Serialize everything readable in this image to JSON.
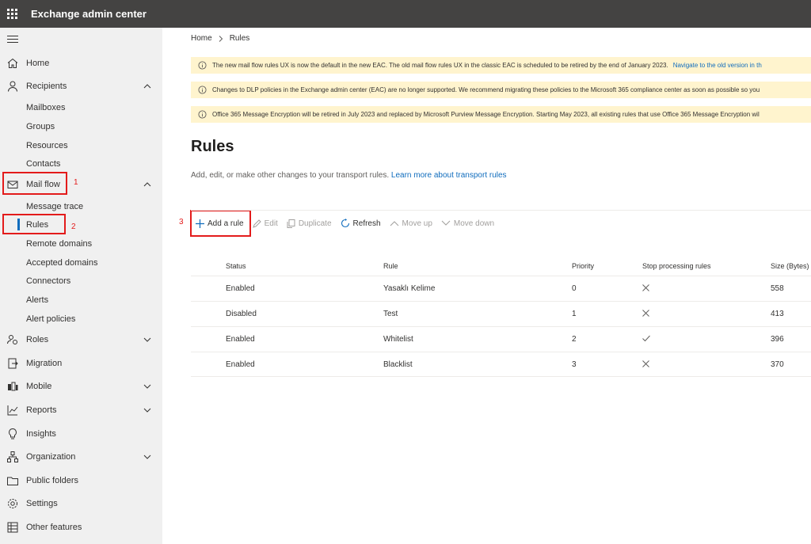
{
  "app": {
    "title": "Exchange admin center"
  },
  "sidebar": {
    "items": [
      {
        "label": "Home"
      },
      {
        "label": "Recipients"
      },
      {
        "label": "Mail flow"
      },
      {
        "label": "Roles"
      },
      {
        "label": "Migration"
      },
      {
        "label": "Mobile"
      },
      {
        "label": "Reports"
      },
      {
        "label": "Insights"
      },
      {
        "label": "Organization"
      },
      {
        "label": "Public folders"
      },
      {
        "label": "Settings"
      },
      {
        "label": "Other features"
      }
    ],
    "recipients_sub": [
      "Mailboxes",
      "Groups",
      "Resources",
      "Contacts"
    ],
    "mailflow_sub": [
      "Message trace",
      "Rules",
      "Remote domains",
      "Accepted domains",
      "Connectors",
      "Alerts",
      "Alert policies"
    ]
  },
  "annotations": [
    "1",
    "2",
    "3"
  ],
  "breadcrumb": {
    "home": "Home",
    "current": "Rules"
  },
  "banners": [
    {
      "text": "The new mail flow rules UX is now the default in the new EAC. The old mail flow rules UX in the classic EAC is scheduled to be retired by the end of January 2023.",
      "link": "Navigate to the old version in th"
    },
    {
      "text": "Changes to DLP policies in the Exchange admin center (EAC) are no longer supported. We recommend migrating these policies to the Microsoft 365 compliance center as soon as possible so you",
      "link": ""
    },
    {
      "text": "Office 365 Message Encryption will be retired in July 2023 and replaced by Microsoft Purview Message Encryption. Starting May 2023, all existing rules that use Office 365 Message Encryption wil",
      "link": ""
    }
  ],
  "page": {
    "title": "Rules",
    "description": "Add, edit, or make other changes to your transport rules.",
    "description_link": "Learn more about transport rules"
  },
  "toolbar": {
    "add": "Add a rule",
    "edit": "Edit",
    "duplicate": "Duplicate",
    "refresh": "Refresh",
    "move_up": "Move up",
    "move_down": "Move down"
  },
  "table": {
    "headers": [
      "Status",
      "Rule",
      "Priority",
      "Stop processing rules",
      "Size (Bytes)"
    ],
    "rows": [
      {
        "status": "Enabled",
        "rule": "Yasaklı Kelime",
        "priority": "0",
        "stop": "x-icon",
        "size": "558"
      },
      {
        "status": "Disabled",
        "rule": "Test",
        "priority": "1",
        "stop": "x-icon",
        "size": "413"
      },
      {
        "status": "Enabled",
        "rule": "Whitelist",
        "priority": "2",
        "stop": "check-icon",
        "size": "396"
      },
      {
        "status": "Enabled",
        "rule": "Blacklist",
        "priority": "3",
        "stop": "x-icon",
        "size": "370"
      }
    ]
  },
  "colors": {
    "topbar": "#444342",
    "sidebar": "#f0f0f0",
    "accent": "#0f6cbd",
    "annotation": "#e31b1b",
    "banner": "#fff4ce"
  }
}
